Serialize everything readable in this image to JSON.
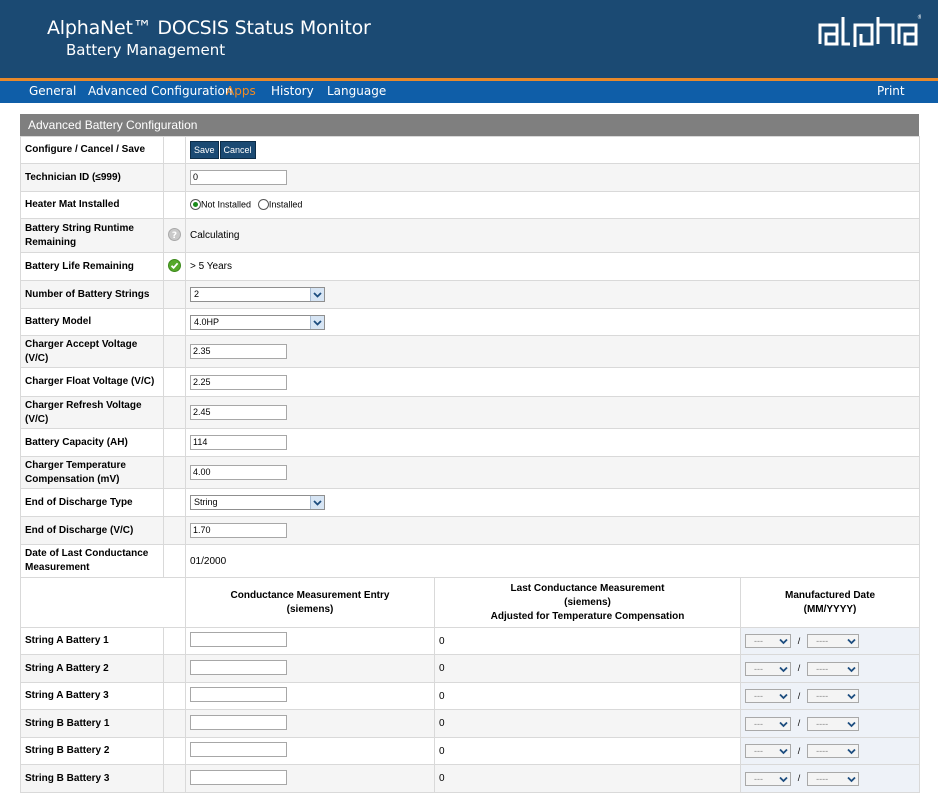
{
  "header": {
    "title": "AlphaNet™ DOCSIS Status Monitor",
    "subtitle": "Battery Management",
    "logo_text": "alpha"
  },
  "nav": {
    "items": [
      "General",
      "Advanced Configuration",
      "Apps",
      "History",
      "Language"
    ],
    "active": "Apps",
    "print": "Print"
  },
  "colors": {
    "header_bg": "#1b4a73",
    "nav_bg": "#0f5ea8",
    "accent": "#f08a24",
    "panel_header": "#7f7f7f"
  },
  "panel": {
    "title": "Advanced Battery Configuration"
  },
  "form": {
    "configure": {
      "label": "Configure / Cancel / Save",
      "save": "Save",
      "cancel": "Cancel"
    },
    "technician_id": {
      "label": "Technician ID (≤999)",
      "value": "0"
    },
    "heater_mat": {
      "label": "Heater Mat Installed",
      "opt1": "Not Installed",
      "opt2": "Installed",
      "selected": "Not Installed"
    },
    "runtime": {
      "label": "Battery String Runtime Remaining",
      "value": "Calculating",
      "icon": "question-icon"
    },
    "life": {
      "label": "Battery Life Remaining",
      "value": "> 5 Years",
      "icon": "check-icon"
    },
    "num_strings": {
      "label": "Number of Battery Strings",
      "value": "2"
    },
    "model": {
      "label": "Battery Model",
      "value": "4.0HP"
    },
    "accept_v": {
      "label": "Charger Accept Voltage (V/C)",
      "value": "2.35"
    },
    "float_v": {
      "label": "Charger Float Voltage (V/C)",
      "value": "2.25"
    },
    "refresh_v": {
      "label": "Charger Refresh Voltage (V/C)",
      "value": "2.45"
    },
    "capacity": {
      "label": "Battery Capacity (AH)",
      "value": "114"
    },
    "temp_comp": {
      "label": "Charger Temperature Compensation (mV)",
      "value": "4.00"
    },
    "eod_type": {
      "label": "End of Discharge Type",
      "value": "String"
    },
    "eod": {
      "label": "End of Discharge (V/C)",
      "value": "1.70"
    },
    "last_cond": {
      "label": "Date of Last Conductance Measurement",
      "value": "01/2000"
    }
  },
  "cond_table": {
    "col_entry_1": "Conductance Measurement Entry",
    "col_entry_2": "(siemens)",
    "col_last_1": "Last Conductance Measurement",
    "col_last_2": "(siemens)",
    "col_last_3": "Adjusted for Temperature Compensation",
    "col_mfg_1": "Manufactured Date",
    "col_mfg_2": "(MM/YYYY)",
    "month_placeholder": "---",
    "year_placeholder": "----",
    "sep": "/",
    "rows": [
      {
        "label": "String A Battery 1",
        "last": "0"
      },
      {
        "label": "String A Battery 2",
        "last": "0"
      },
      {
        "label": "String A Battery 3",
        "last": "0"
      },
      {
        "label": "String B Battery 1",
        "last": "0"
      },
      {
        "label": "String B Battery 2",
        "last": "0"
      },
      {
        "label": "String B Battery 3",
        "last": "0"
      }
    ]
  }
}
